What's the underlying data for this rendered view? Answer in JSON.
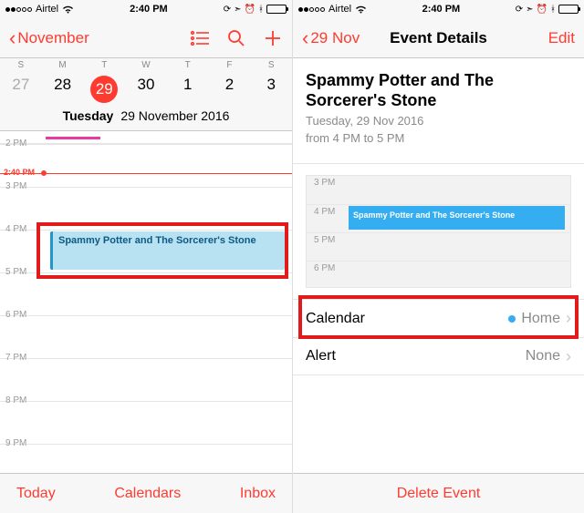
{
  "status": {
    "carrier": "Airtel",
    "time": "2:40 PM"
  },
  "left": {
    "back": "November",
    "weekdays": [
      "S",
      "M",
      "T",
      "W",
      "T",
      "F",
      "S"
    ],
    "daynums": [
      "27",
      "28",
      "29",
      "30",
      "1",
      "2",
      "3"
    ],
    "selected_index": 2,
    "full_weekday": "Tuesday",
    "full_date": "29 November 2016",
    "now_label": "2:40 PM",
    "hours": [
      "2 PM",
      "3 PM",
      "4 PM",
      "5 PM",
      "6 PM",
      "7 PM",
      "8 PM",
      "9 PM"
    ],
    "event_title": "Spammy Potter and The Sorcerer's Stone",
    "toolbar": {
      "today": "Today",
      "calendars": "Calendars",
      "inbox": "Inbox"
    }
  },
  "right": {
    "back": "29 Nov",
    "title": "Event Details",
    "edit": "Edit",
    "event_title": "Spammy Potter and The Sorcerer's Stone",
    "event_date": "Tuesday, 29 Nov 2016",
    "event_time": "from 4 PM to 5 PM",
    "mini_hours": [
      "3 PM",
      "4 PM",
      "5 PM",
      "6 PM"
    ],
    "mini_event": "Spammy Potter and The Sorcerer's Stone",
    "row_calendar_label": "Calendar",
    "row_calendar_value": "Home",
    "row_alert_label": "Alert",
    "row_alert_value": "None",
    "delete": "Delete Event"
  }
}
